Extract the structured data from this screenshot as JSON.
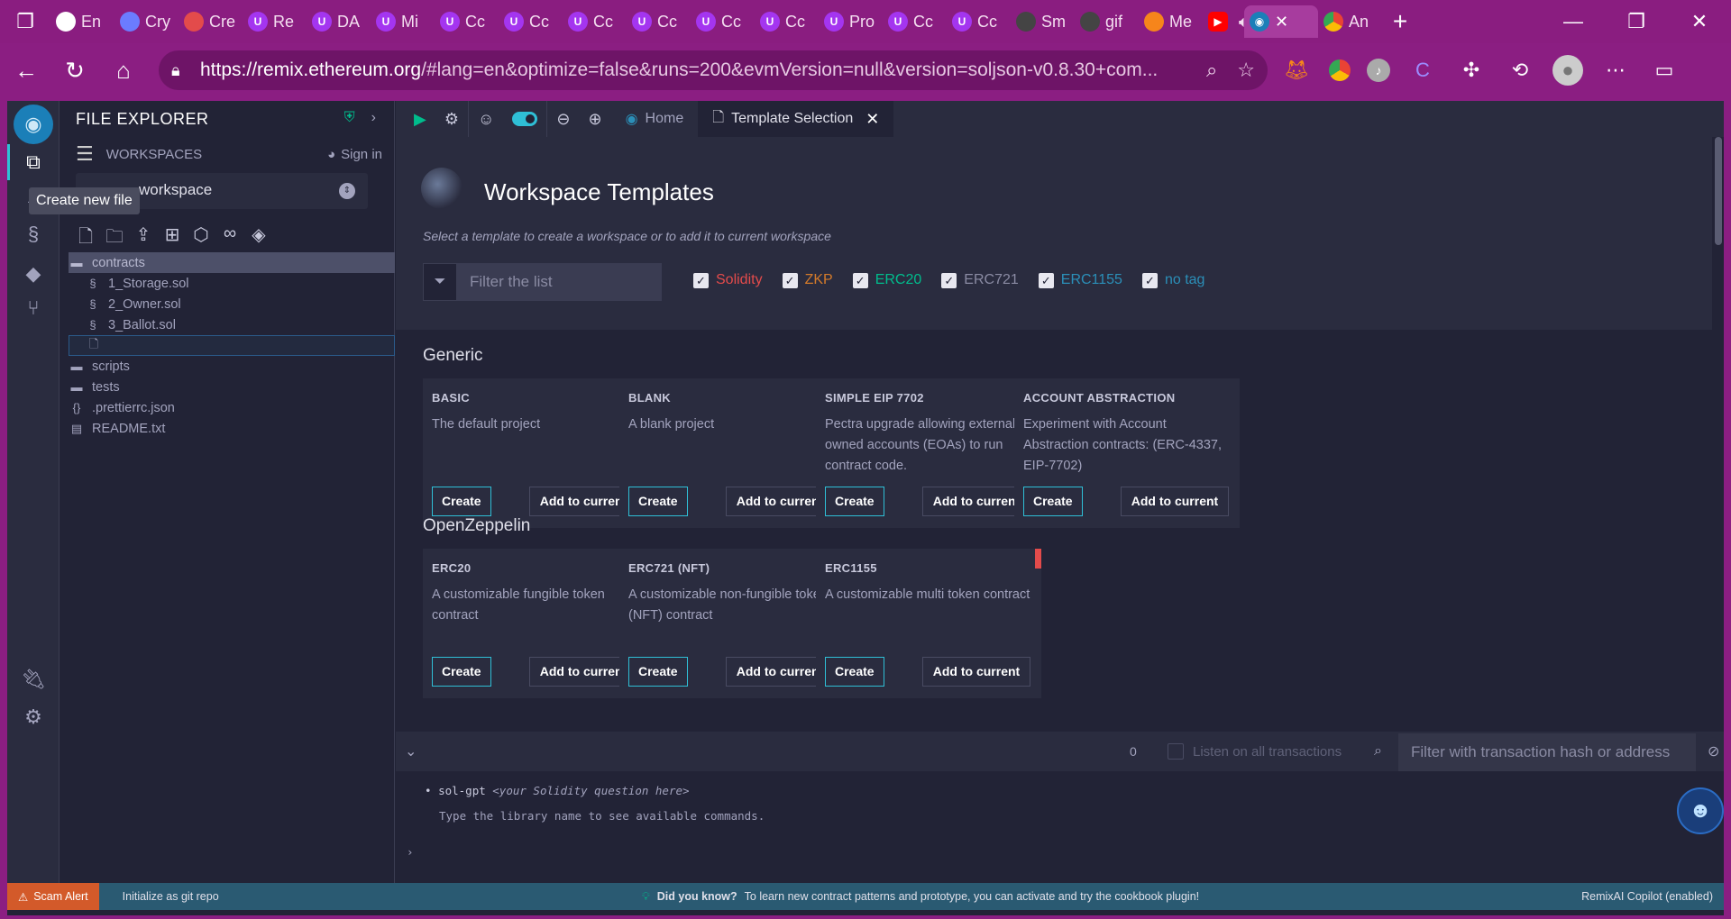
{
  "browser": {
    "tabs": [
      {
        "label": "En",
        "icon": "chatgpt-icon",
        "color": "#ffffff"
      },
      {
        "label": "Cry",
        "icon": "crypto-icon",
        "color": "#6b7cff"
      },
      {
        "label": "Cre",
        "icon": "pdf-icon",
        "color": "#e34b4b"
      },
      {
        "label": "Re",
        "icon": "udemy-icon",
        "color": "#a435f0"
      },
      {
        "label": "DA",
        "icon": "udemy-icon",
        "color": "#a435f0"
      },
      {
        "label": "Mi",
        "icon": "udemy-icon",
        "color": "#a435f0"
      },
      {
        "label": "Cc",
        "icon": "udemy-icon",
        "color": "#a435f0"
      },
      {
        "label": "Cc",
        "icon": "udemy-icon",
        "color": "#a435f0"
      },
      {
        "label": "Cc",
        "icon": "udemy-icon",
        "color": "#a435f0"
      },
      {
        "label": "Cc",
        "icon": "udemy-icon",
        "color": "#a435f0"
      },
      {
        "label": "Cc",
        "icon": "udemy-icon",
        "color": "#a435f0"
      },
      {
        "label": "Cc",
        "icon": "udemy-icon",
        "color": "#a435f0"
      },
      {
        "label": "Pro",
        "icon": "udemy-icon",
        "color": "#a435f0"
      },
      {
        "label": "Cc",
        "icon": "udemy-icon",
        "color": "#a435f0"
      },
      {
        "label": "Cc",
        "icon": "udemy-icon",
        "color": "#a435f0"
      },
      {
        "label": "Sm",
        "icon": "sm-icon",
        "color": "#444444"
      },
      {
        "label": "gif",
        "icon": "gif-icon",
        "color": "#444444"
      },
      {
        "label": "Me",
        "icon": "metamask-icon",
        "color": "#f6851b"
      },
      {
        "label": "",
        "icon": "youtube-icon",
        "color": "#ff0000"
      }
    ],
    "active_tab_icon": "remix-icon",
    "last_tab": {
      "label": "An",
      "icon": "chrome-icon"
    },
    "url_host": "https://remix.ethereum.org",
    "url_rest": "/#lang=en&optimize=false&runs=200&evmVersion=null&version=soljson-v0.8.30+com..."
  },
  "sidepanel": {
    "title": "FILE EXPLORER",
    "workspaces_label": "WORKSPACES",
    "signin_label": "Sign in",
    "workspace_name": "workspace",
    "tooltip": "Create new file",
    "tree": [
      {
        "label": "contracts",
        "type": "folder",
        "indent": 1,
        "selected": true
      },
      {
        "label": "1_Storage.sol",
        "type": "sol",
        "indent": 2
      },
      {
        "label": "2_Owner.sol",
        "type": "sol",
        "indent": 2
      },
      {
        "label": "3_Ballot.sol",
        "type": "sol",
        "indent": 2
      },
      {
        "label": "",
        "type": "new-file",
        "indent": 2,
        "editing": true
      },
      {
        "label": "scripts",
        "type": "folder",
        "indent": 1
      },
      {
        "label": "tests",
        "type": "folder",
        "indent": 1
      },
      {
        "label": ".prettierrc.json",
        "type": "json",
        "indent": 1
      },
      {
        "label": "README.txt",
        "type": "txt",
        "indent": 1
      }
    ]
  },
  "topbar": {
    "home_tab": "Home",
    "active_tab": "Template Selection"
  },
  "templates": {
    "title": "Workspace Templates",
    "subtitle": "Select a template to create a workspace or to add it to current workspace",
    "filter_placeholder": "Filter the list",
    "tags": [
      {
        "label": "Solidity",
        "color": "#e34b4b"
      },
      {
        "label": "ZKP",
        "color": "#d37a2a"
      },
      {
        "label": "ERC20",
        "color": "#00bc8c"
      },
      {
        "label": "ERC721",
        "color": "#8a8ba3"
      },
      {
        "label": "ERC1155",
        "color": "#2b8fb8"
      },
      {
        "label": "no tag",
        "color": "#2b8fb8"
      }
    ],
    "create_label": "Create",
    "add_label": "Add to current",
    "sections": [
      {
        "title": "Generic",
        "cards": [
          {
            "title": "BASIC",
            "desc": "The default project",
            "stripes": [
              "#e34b4b"
            ]
          },
          {
            "title": "BLANK",
            "desc": "A blank project",
            "stripes": []
          },
          {
            "title": "SIMPLE EIP 7702",
            "desc": "Pectra upgrade allowing externally owned accounts (EOAs) to run contract code.",
            "stripes": []
          },
          {
            "title": "ACCOUNT ABSTRACTION",
            "desc": "Experiment with Account Abstraction contracts: (ERC-4337, EIP-7702)",
            "stripes": []
          }
        ]
      },
      {
        "title": "OpenZeppelin",
        "cards": [
          {
            "title": "ERC20",
            "desc": "A customizable fungible token contract",
            "stripes": [
              "#00bc8c",
              "#e34b4b"
            ]
          },
          {
            "title": "ERC721 (NFT)",
            "desc": "A customizable non-fungible token (NFT) contract",
            "stripes": [
              "#5f6178",
              "#e34b4b"
            ]
          },
          {
            "title": "ERC1155",
            "desc": "A customizable multi token contract",
            "stripes": [
              "#e34b4b"
            ]
          }
        ]
      }
    ]
  },
  "terminal": {
    "count": "0",
    "listen_label": "Listen on all transactions",
    "filter_placeholder": "Filter with transaction hash or address",
    "line1_cmd": "sol-gpt",
    "line1_arg": "<your Solidity question here>",
    "line2": "Type the library name to see available commands."
  },
  "statusbar": {
    "scam": "Scam Alert",
    "git": "Initialize as git repo",
    "tip_label": "Did you know?",
    "tip_text": "To learn new contract patterns and prototype, you can activate and try the cookbook plugin!",
    "copilot": "RemixAI Copilot (enabled)"
  }
}
